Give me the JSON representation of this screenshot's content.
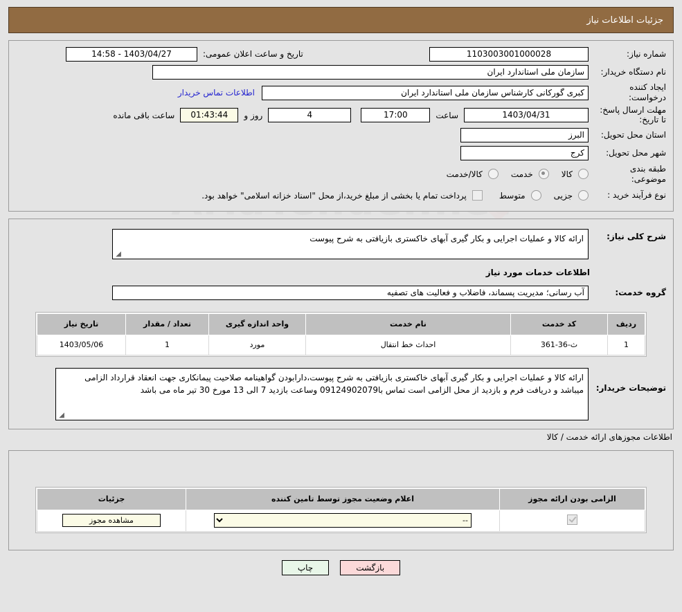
{
  "header": {
    "title": "جزئیات اطلاعات نیاز",
    "bar_color": "#916b42"
  },
  "watermark": {
    "text": "AriaTender.net"
  },
  "summary": {
    "need_number_label": "شماره نیاز:",
    "need_number_value": "1103003001000028",
    "public_announce_label": "تاریخ و ساعت اعلان عمومی:",
    "public_announce_value": "1403/04/27 - 14:58",
    "buyer_org_label": "نام دستگاه خریدار:",
    "buyer_org_value": "سازمان ملی استاندارد ایران",
    "creator_label": "ایجاد کننده درخواست:",
    "creator_value": "کبری گورکانی کارشناس سازمان ملی استاندارد ایران",
    "buyer_contact_link": "اطلاعات تماس خریدار",
    "deadline_label": "مهلت ارسال پاسخ: تا تاریخ:",
    "deadline_date": "1403/04/31",
    "deadline_hour_label": "ساعت",
    "deadline_hour": "17:00",
    "remaining_days": "4",
    "remaining_days_label": "روز و",
    "remaining_time": "01:43:44",
    "remaining_time_label": "ساعت باقی مانده",
    "province_label": "استان محل تحویل:",
    "province_value": "البرز",
    "city_label": "شهر محل تحویل:",
    "city_value": "کرج",
    "category_label": "طبقه بندی موضوعی:",
    "category_options": [
      {
        "label": "کالا",
        "checked": false
      },
      {
        "label": "خدمت",
        "checked": true
      },
      {
        "label": "کالا/خدمت",
        "checked": false
      }
    ],
    "process_label": "نوع فرآیند خرید :",
    "process_options": [
      {
        "label": "جزیی",
        "checked": false
      },
      {
        "label": "متوسط",
        "checked": false
      }
    ],
    "treasury_checkbox_checked": false,
    "treasury_note": "پرداخت تمام یا بخشی از مبلغ خرید،از محل \"اسناد خزانه اسلامی\" خواهد بود."
  },
  "needs": {
    "general_desc_label": "شرح کلی نیاز:",
    "general_desc_value": "ارائه کالا و عملیات اجرایی و بکار گیری آبهای خاکستری بازیافتی به شرح  پیوست",
    "services_info_title": "اطلاعات خدمات مورد نیاز",
    "service_group_label": "گروه خدمت:",
    "service_group_value": "آب رسانی؛ مدیریت پسماند، فاضلاب و فعالیت های تصفیه",
    "table": {
      "columns": [
        "ردیف",
        "کد خدمت",
        "نام خدمت",
        "واحد اندازه گیری",
        "تعداد / مقدار",
        "تاریخ نیاز"
      ],
      "rows": [
        [
          "1",
          "ث-36-361",
          "احداث خط انتقال",
          "مورد",
          "1",
          "1403/05/06"
        ]
      ]
    },
    "buyer_notes_label": "توضیحات خریدار:",
    "buyer_notes_value": "ارائه کالا و عملیات اجرایی و بکار گیری آبهای خاکستری بازیافتی به شرح  پیوست،دارابودن گواهینامه صلاحیت پیمانکاری جهت انعقاد قرارداد الزامی میباشد و دریافت فرم و بازدید از محل الزامی است تماس با09124902079 وساعت بازدید 7 الی 13 مورخ 30 تیر ماه می باشد"
  },
  "permits": {
    "section_note": "اطلاعات مجوزهای ارائه خدمت / کالا",
    "table": {
      "columns": [
        "الزامی بودن ارائه مجوز",
        "اعلام وضعیت مجوز توسط تامین کننده",
        "جزئیات"
      ],
      "rows": [
        {
          "required_checked": true,
          "status_selected": "--",
          "status_options": [
            "--"
          ],
          "details_button": "مشاهده مجوز"
        }
      ]
    }
  },
  "footer": {
    "print_button": "چاپ",
    "back_button": "بازگشت"
  }
}
